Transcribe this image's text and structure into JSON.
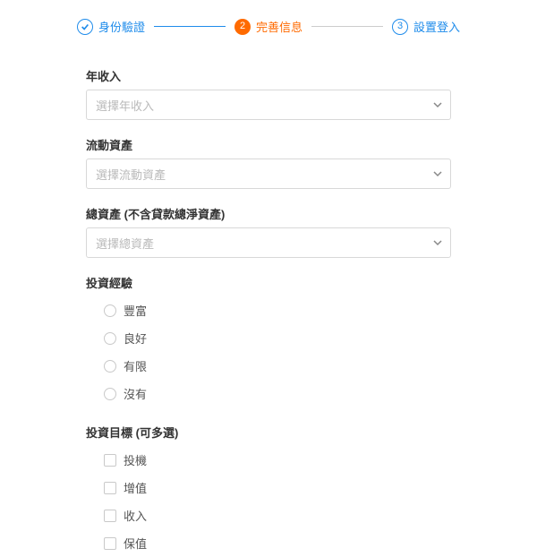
{
  "colors": {
    "accent_blue": "#1f8ceb",
    "accent_orange": "#ff6a00"
  },
  "stepper": {
    "step1": {
      "label": "身份驗證",
      "state": "done"
    },
    "step2": {
      "label": "完善信息",
      "state": "active",
      "number": "2"
    },
    "step3": {
      "label": "設置登入",
      "state": "todo",
      "number": "3"
    }
  },
  "fields": {
    "annual_income": {
      "label": "年收入",
      "placeholder": "選擇年收入"
    },
    "liquid_assets": {
      "label": "流動資產",
      "placeholder": "選擇流動資產"
    },
    "total_assets": {
      "label": "總資產 (不含貸款總淨資產)",
      "placeholder": "選擇總資產"
    },
    "experience": {
      "label": "投資經驗",
      "options": [
        "豐富",
        "良好",
        "有限",
        "沒有"
      ]
    },
    "goals": {
      "label": "投資目標 (可多選)",
      "options": [
        "投機",
        "增值",
        "收入",
        "保值"
      ]
    }
  }
}
